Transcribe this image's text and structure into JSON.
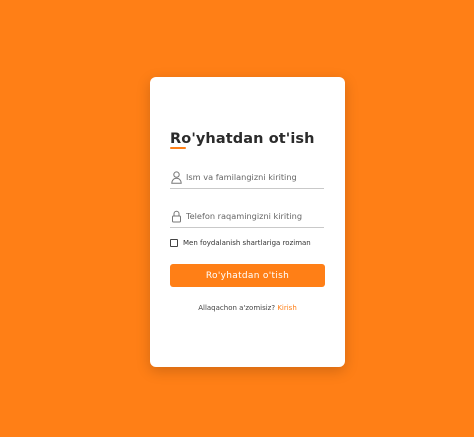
{
  "colors": {
    "background": "#ff7f16",
    "accent": "#ff7f16",
    "card": "#ffffff"
  },
  "form": {
    "title": "Ro'yhatdan ot'ish",
    "name_field": {
      "icon": "user-icon",
      "placeholder": "Ism va familangizni kiriting",
      "value": ""
    },
    "phone_field": {
      "icon": "lock-icon",
      "placeholder": "Telefon raqamingizni kiriting",
      "value": ""
    },
    "terms": {
      "label": "Men foydalanish shartlariga roziman",
      "checked": false
    },
    "submit_label": "Ro'yhatdan o'tish",
    "login_prompt": "Allaqachon a'zomisiz?",
    "login_link": "Kirish"
  }
}
